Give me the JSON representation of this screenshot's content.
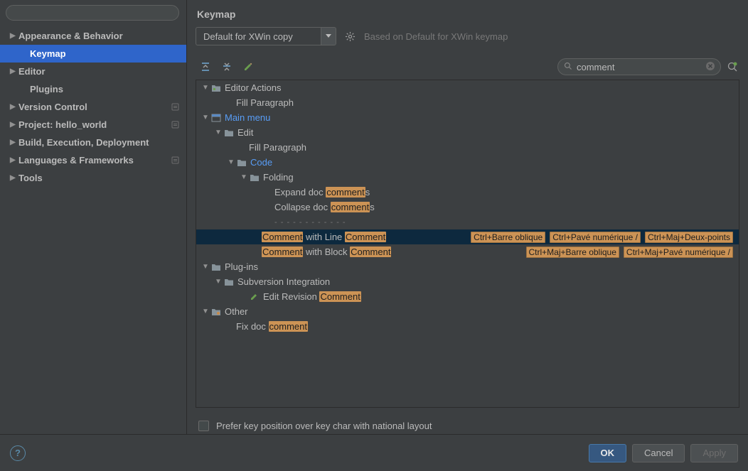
{
  "sidebar": {
    "search_placeholder": "",
    "items": [
      {
        "label": "Appearance & Behavior",
        "expandable": true,
        "indent": 0
      },
      {
        "label": "Keymap",
        "expandable": false,
        "indent": 1,
        "selected": true
      },
      {
        "label": "Editor",
        "expandable": true,
        "indent": 0
      },
      {
        "label": "Plugins",
        "expandable": false,
        "indent": 1
      },
      {
        "label": "Version Control",
        "expandable": true,
        "indent": 0,
        "badge": true
      },
      {
        "label": "Project: hello_world",
        "expandable": true,
        "indent": 0,
        "badge": true
      },
      {
        "label": "Build, Execution, Deployment",
        "expandable": true,
        "indent": 0
      },
      {
        "label": "Languages & Frameworks",
        "expandable": true,
        "indent": 0,
        "badge": true
      },
      {
        "label": "Tools",
        "expandable": true,
        "indent": 0
      }
    ]
  },
  "content": {
    "title": "Keymap",
    "keymap_name": "Default for XWin copy",
    "based_on": "Based on Default for XWin keymap",
    "filter_value": "comment",
    "prefer_checkbox_label": "Prefer key position over key char with national layout"
  },
  "tree": {
    "rows": [
      {
        "depth": 0,
        "toggle": "open",
        "icon": "folder-actions",
        "label": "Editor Actions"
      },
      {
        "depth": 2,
        "label": "Fill Paragraph"
      },
      {
        "depth": 0,
        "toggle": "open",
        "icon": "menu",
        "label": "Main menu",
        "link": true
      },
      {
        "depth": 1,
        "toggle": "open",
        "icon": "folder",
        "label": "Edit"
      },
      {
        "depth": 3,
        "label": "Fill Paragraph"
      },
      {
        "depth": 2,
        "toggle": "open",
        "icon": "folder",
        "label": "Code",
        "link": true
      },
      {
        "depth": 3,
        "toggle": "open",
        "icon": "folder",
        "label": "Folding"
      },
      {
        "depth": 5,
        "label_parts": [
          "Expand doc ",
          "comment",
          "s"
        ]
      },
      {
        "depth": 5,
        "label_parts": [
          "Collapse doc ",
          "comment",
          "s"
        ]
      },
      {
        "depth": 5,
        "divider": true
      },
      {
        "depth": 4,
        "label_parts": [
          "Comment",
          " with Line ",
          "Comment"
        ],
        "hl_idx": [
          0,
          2
        ],
        "selected": true,
        "shortcuts": [
          "Ctrl+Barre oblique",
          "Ctrl+Pavé numérique /",
          "Ctrl+Maj+Deux-points"
        ]
      },
      {
        "depth": 4,
        "label_parts": [
          "Comment",
          " with Block ",
          "Comment"
        ],
        "hl_idx": [
          0,
          2
        ],
        "shortcuts": [
          "Ctrl+Maj+Barre oblique",
          "Ctrl+Maj+Pavé numérique /"
        ]
      },
      {
        "depth": 0,
        "toggle": "open",
        "icon": "folder",
        "label": "Plug-ins"
      },
      {
        "depth": 1,
        "toggle": "open",
        "icon": "folder",
        "label": "Subversion Integration"
      },
      {
        "depth": 3,
        "icon": "pencil",
        "label_parts": [
          "Edit Revision ",
          "Comment"
        ],
        "hl_idx": [
          1
        ]
      },
      {
        "depth": 0,
        "toggle": "open",
        "icon": "folder-other",
        "label": "Other"
      },
      {
        "depth": 2,
        "label_parts": [
          "Fix doc ",
          "comment"
        ],
        "hl_idx": [
          1
        ]
      }
    ]
  },
  "footer": {
    "ok": "OK",
    "cancel": "Cancel",
    "apply": "Apply"
  }
}
